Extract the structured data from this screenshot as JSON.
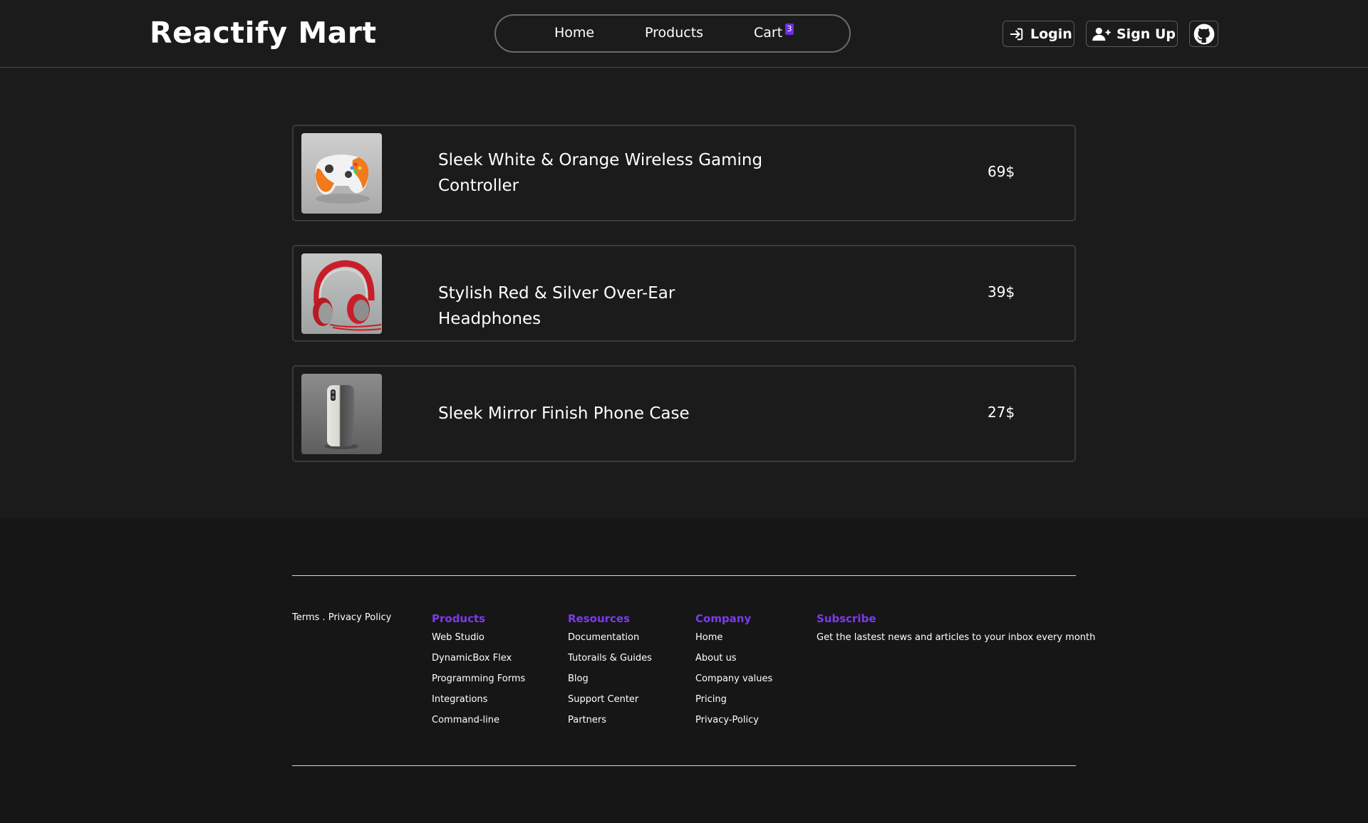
{
  "brand": {
    "name": "Reactify Mart"
  },
  "nav": {
    "home": "Home",
    "products": "Products",
    "cart": "Cart",
    "cart_count": "3"
  },
  "auth": {
    "login": "Login",
    "signup": "Sign Up",
    "github_icon": "github-icon"
  },
  "cart_items": [
    {
      "title": "Sleek White & Orange Wireless Gaming Controller",
      "price": "69$",
      "image": "gaming-controller-image"
    },
    {
      "title": "Stylish Red & Silver Over-Ear Headphones",
      "price": "39$",
      "image": "headphones-image"
    },
    {
      "title": "Sleek Mirror Finish Phone Case",
      "price": "27$",
      "image": "phone-case-image"
    }
  ],
  "footer": {
    "legal": {
      "terms": "Terms",
      "separator": " . ",
      "privacy": "Privacy Policy"
    },
    "columns": [
      {
        "title": "Products",
        "links": [
          "Web Studio",
          "DynamicBox Flex",
          "Programming Forms",
          "Integrations",
          "Command-line"
        ]
      },
      {
        "title": "Resources",
        "links": [
          "Documentation",
          "Tutorails & Guides",
          "Blog",
          "Support Center",
          "Partners"
        ]
      },
      {
        "title": "Company",
        "links": [
          "Home",
          "About us",
          "Company values",
          "Pricing",
          "Privacy-Policy"
        ]
      }
    ],
    "subscribe": {
      "title": "Subscribe",
      "text": "Get the lastest news and articles to your inbox every month"
    }
  },
  "colors": {
    "background": "#1b1b1b",
    "footer_background": "#161616",
    "accent": "#7c3aed",
    "badge": "#6b2fe0",
    "text": "#ffffff"
  }
}
